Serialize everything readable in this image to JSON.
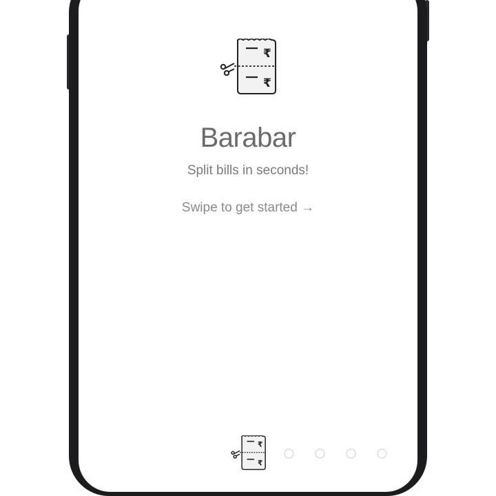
{
  "app": {
    "title": "Barabar",
    "tagline": "Split bills in seconds!",
    "swipe_hint": "Swipe to get started →"
  },
  "icons": {
    "logo": "split-receipt-icon",
    "scissors": "scissors-icon",
    "currency_symbol": "₹"
  },
  "pager": {
    "total_pages": 5,
    "current_page": 1
  },
  "colors": {
    "title": "#6b6b6b",
    "text": "#7a7a7a",
    "frame": "#1c1c1e",
    "dot": "#e3e3e3"
  }
}
